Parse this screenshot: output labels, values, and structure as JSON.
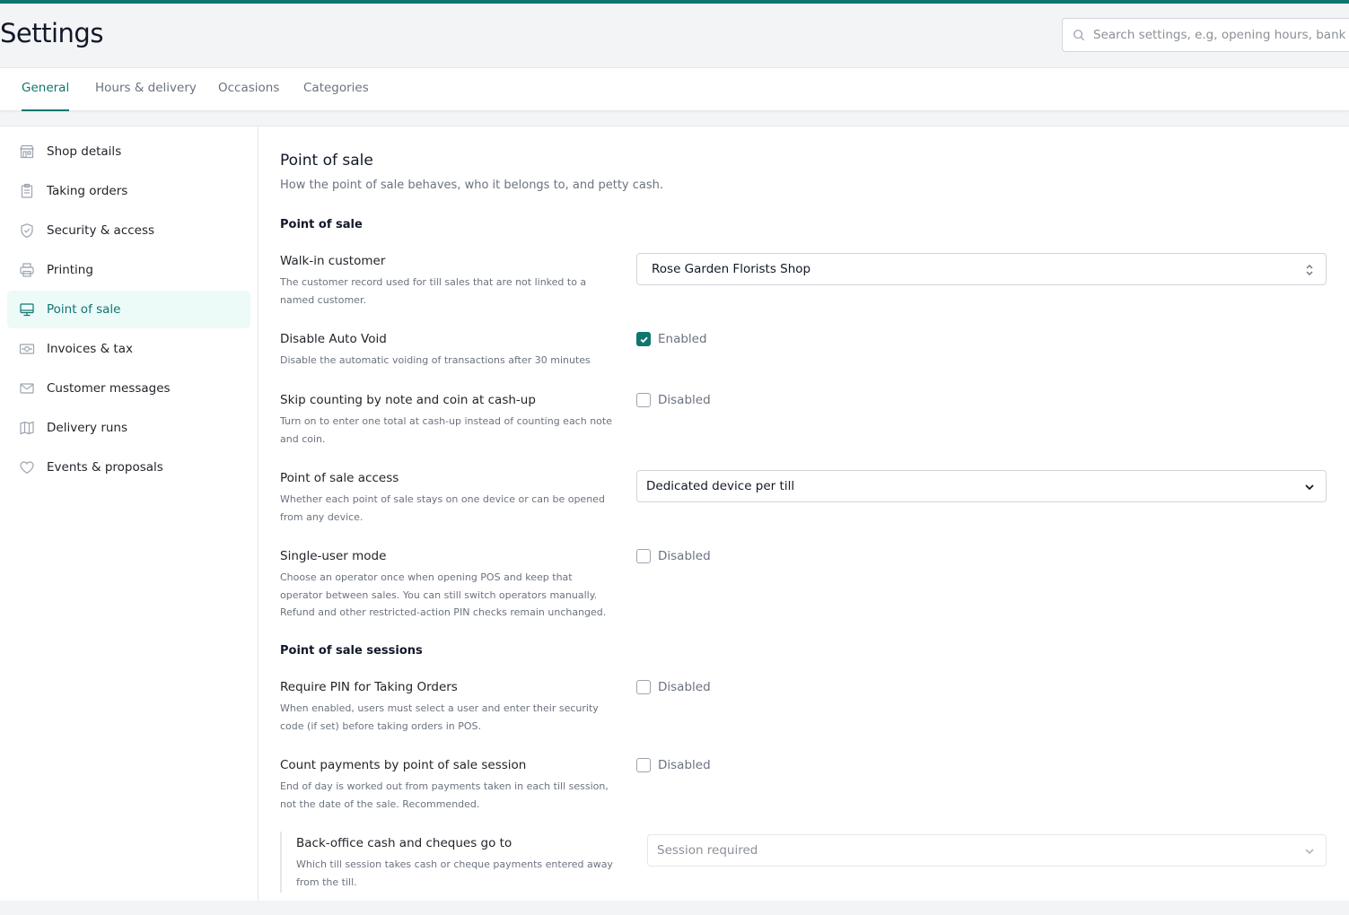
{
  "colors": {
    "accent": "#0f766e",
    "active_bg": "#ecfaf8",
    "background": "#f3f4f6"
  },
  "header": {
    "title": "Settings",
    "search": {
      "placeholder": "Search settings, e.g, opening hours, bank c",
      "icon": "search-icon"
    }
  },
  "tabs": [
    {
      "label": "General",
      "active": true
    },
    {
      "label": "Hours & delivery",
      "active": false
    },
    {
      "label": "Occasions",
      "active": false
    },
    {
      "label": "Categories",
      "active": false
    }
  ],
  "sidebar": {
    "items": [
      {
        "label": "Shop details",
        "icon": "shop-icon",
        "active": false
      },
      {
        "label": "Taking orders",
        "icon": "clipboard-icon",
        "active": false
      },
      {
        "label": "Security & access",
        "icon": "shield-icon",
        "active": false
      },
      {
        "label": "Printing",
        "icon": "printer-icon",
        "active": false
      },
      {
        "label": "Point of sale",
        "icon": "monitor-icon",
        "active": true
      },
      {
        "label": "Invoices & tax",
        "icon": "banknote-icon",
        "active": false
      },
      {
        "label": "Customer messages",
        "icon": "mail-icon",
        "active": false
      },
      {
        "label": "Delivery runs",
        "icon": "map-icon",
        "active": false
      },
      {
        "label": "Events & proposals",
        "icon": "heart-icon",
        "active": false
      }
    ]
  },
  "main": {
    "title": "Point of sale",
    "subtitle": "How the point of sale behaves, who it belongs to, and petty cash.",
    "groups": {
      "pos": "Point of sale",
      "sessions": "Point of sale sessions"
    },
    "settings": {
      "walk_in": {
        "label": "Walk-in customer",
        "help": "The customer record used for till sales that are not linked to a named customer.",
        "value": "Rose Garden Florists Shop"
      },
      "auto_void": {
        "label": "Disable Auto Void",
        "help": "Disable the automatic voiding of transactions after 30 minutes",
        "state": "Enabled",
        "checked": true
      },
      "skip_counting": {
        "label": "Skip counting by note and coin at cash-up",
        "help": "Turn on to enter one total at cash-up instead of counting each note and coin.",
        "state": "Disabled",
        "checked": false
      },
      "pos_access": {
        "label": "Point of sale access",
        "help": "Whether each point of sale stays on one device or can be opened from any device.",
        "value": "Dedicated device per till"
      },
      "single_user": {
        "label": "Single-user mode",
        "help": "Choose an operator once when opening POS and keep that operator between sales. You can still switch operators manually. Refund and other restricted-action PIN checks remain unchanged.",
        "state": "Disabled",
        "checked": false
      },
      "require_pin": {
        "label": "Require PIN for Taking Orders",
        "help": "When enabled, users must select a user and enter their security code (if set) before taking orders in POS.",
        "state": "Disabled",
        "checked": false
      },
      "count_payments": {
        "label": "Count payments by point of sale session",
        "help": "End of day is worked out from payments taken in each till session, not the date of the sale. Recommended.",
        "state": "Disabled",
        "checked": false
      },
      "back_office": {
        "label": "Back-office cash and cheques go to",
        "help": "Which till session takes cash or cheque payments entered away from the till.",
        "value": "Session required"
      }
    }
  }
}
